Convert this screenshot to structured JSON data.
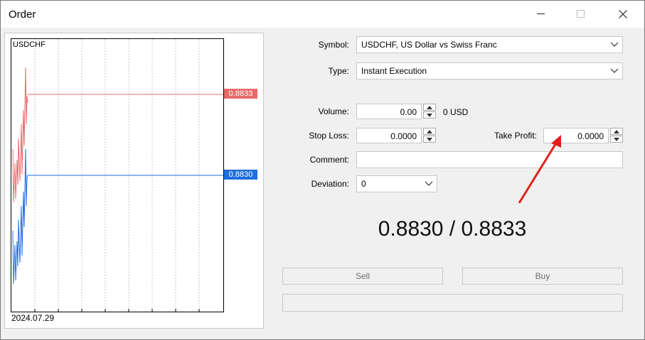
{
  "window": {
    "title": "Order"
  },
  "chart": {
    "symbol": "USDCHF",
    "date_label": "2024.07.29",
    "ask_price": "0.8833",
    "bid_price": "0.8830",
    "ask_color": "#e86b6b",
    "bid_color": "#1f6fe0"
  },
  "form": {
    "symbol_label": "Symbol:",
    "symbol_value": "USDCHF, US Dollar vs Swiss Franc",
    "type_label": "Type:",
    "type_value": "Instant Execution",
    "volume_label": "Volume:",
    "volume_value": "0.00",
    "volume_unit": "0 USD",
    "stop_loss_label": "Stop Loss:",
    "stop_loss_value": "0.0000",
    "take_profit_label": "Take Profit:",
    "take_profit_value": "0.0000",
    "comment_label": "Comment:",
    "comment_value": "",
    "deviation_label": "Deviation:",
    "deviation_value": "0"
  },
  "quote": {
    "text": "0.8830 / 0.8833"
  },
  "actions": {
    "sell_label": "Sell",
    "buy_label": "Buy"
  },
  "annotation": {
    "arrow_color": "#e0201a"
  }
}
